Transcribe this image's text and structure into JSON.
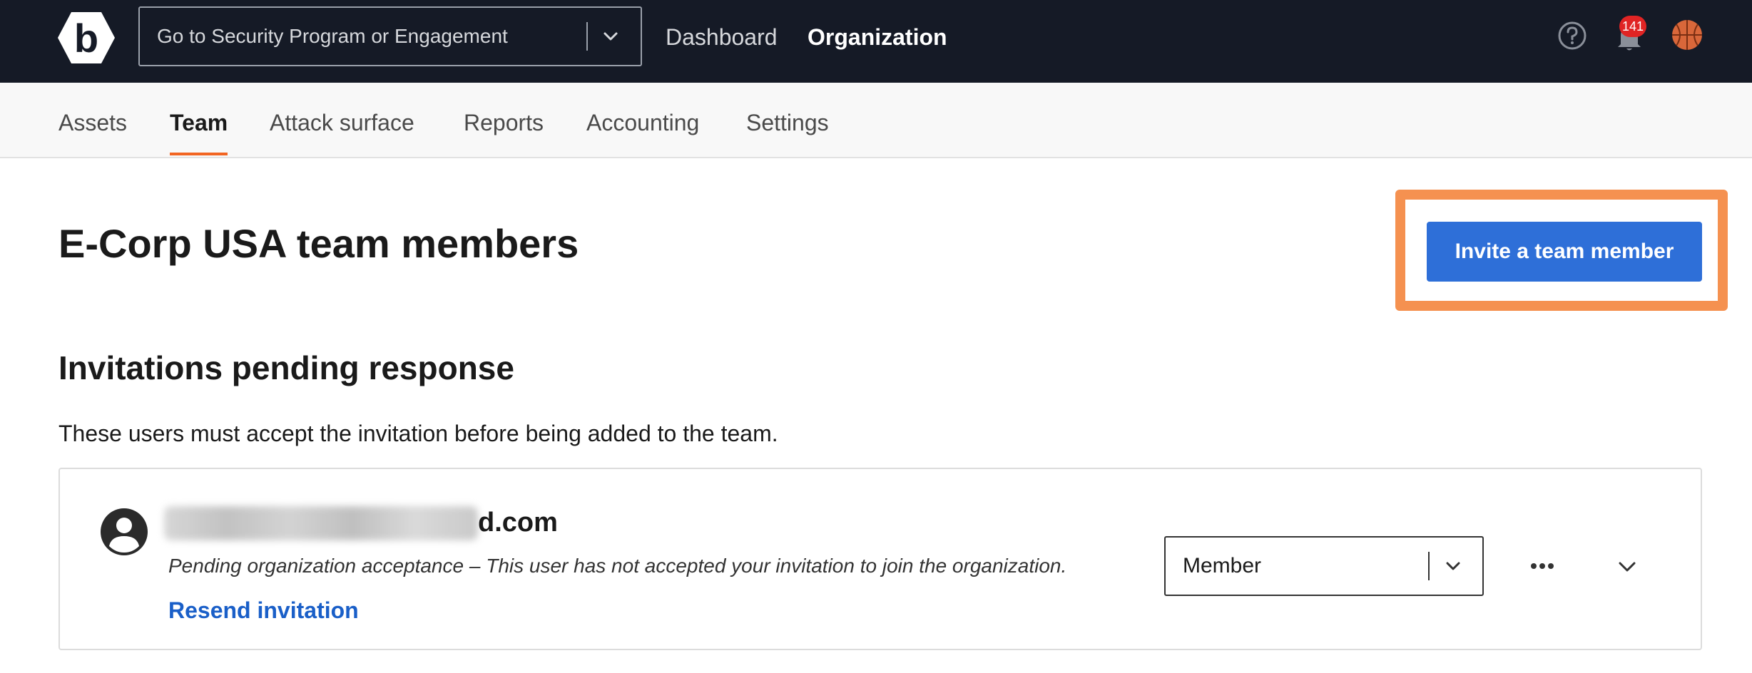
{
  "topbar": {
    "logo_letter": "b",
    "program_select": {
      "placeholder": "Go to Security Program or Engagement"
    },
    "links": {
      "dashboard": "Dashboard",
      "organization": "Organization"
    },
    "notifications_count": "141",
    "icons": {
      "program_select_chevron": "chevron-down-icon",
      "help": "question-circle-icon",
      "notifications": "bell-icon",
      "avatar": "basketball-avatar-icon"
    }
  },
  "subnav": {
    "tabs": [
      "Assets",
      "Team",
      "Attack surface",
      "Reports",
      "Accounting",
      "Settings"
    ],
    "active_tab": "Team"
  },
  "main": {
    "page_title": "E-Corp USA team members",
    "invite_button_label": "Invite a team member",
    "pending_section": {
      "title": "Invitations pending response",
      "description": "These users must accept the invitation before being added to the team.",
      "invitations": [
        {
          "email_visible_suffix": "d.com",
          "status_text": "Pending organization acceptance – This user has not accepted your invitation to join the organization.",
          "resend_label": "Resend invitation",
          "role": "Member"
        }
      ]
    }
  },
  "colors": {
    "topbar_bg": "#151a26",
    "accent_orange": "#f26522",
    "highlight_orange": "#f59150",
    "primary_blue": "#2e6fd8",
    "link_blue": "#1a5fc8",
    "badge_red": "#e02424"
  }
}
